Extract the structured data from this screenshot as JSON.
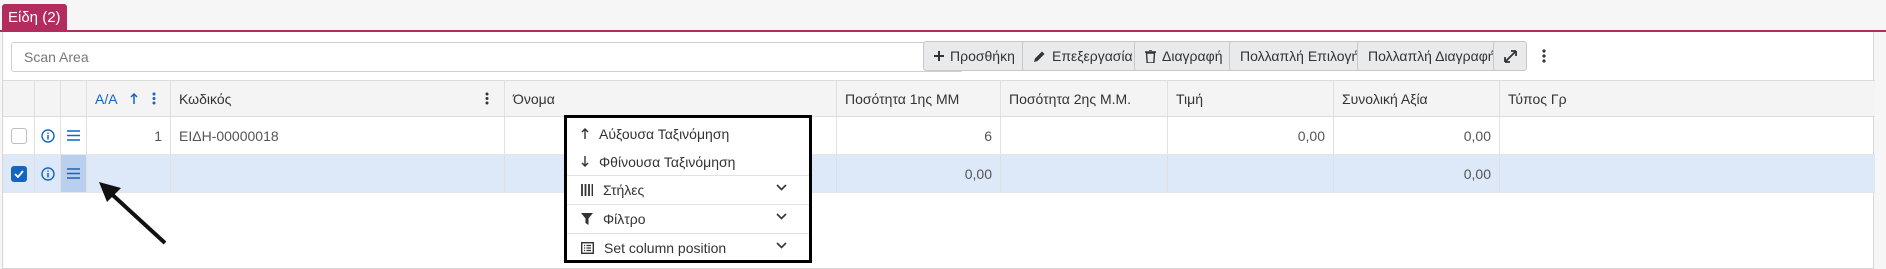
{
  "tab": {
    "label": "Είδη (2)"
  },
  "search": {
    "placeholder": "Scan Area"
  },
  "toolbar": {
    "add_label": "Προσθήκη",
    "edit_label": "Επεξεργασία",
    "delete_label": "Διαγραφή",
    "multi_select_label": "Πολλαπλή Επιλογή",
    "multi_delete_label": "Πολλαπλή Διαγραφή"
  },
  "columns": {
    "aa": "Α/Α",
    "code": "Κωδικός",
    "name": "Όνομα",
    "qty1": "Ποσότητα 1ης ΜΜ",
    "qty2": "Ποσότητα 2ης Μ.Μ.",
    "price": "Τιμή",
    "total": "Συνολική Αξία",
    "type": "Τύπος Γρ"
  },
  "rows": [
    {
      "selected": false,
      "aa": "1",
      "code": "ΕΙΔΗ-00000018",
      "name": "",
      "qty1": "6",
      "qty2": "",
      "price": "0,00",
      "total": "0,00"
    },
    {
      "selected": true,
      "aa": "",
      "code": "",
      "name": "",
      "qty1": "0,00",
      "qty2": "",
      "price": "",
      "total": "0,00"
    }
  ],
  "column_menu": {
    "sort_asc": "Αύξουσα Ταξινόμηση",
    "sort_desc": "Φθίνουσα Ταξινόμηση",
    "columns": "Στήλες",
    "filter": "Φίλτρο",
    "set_position": "Set column position"
  },
  "colors": {
    "tab": "#b32c5e",
    "primary": "#1565c0",
    "selected_row": "#dde8f8"
  }
}
